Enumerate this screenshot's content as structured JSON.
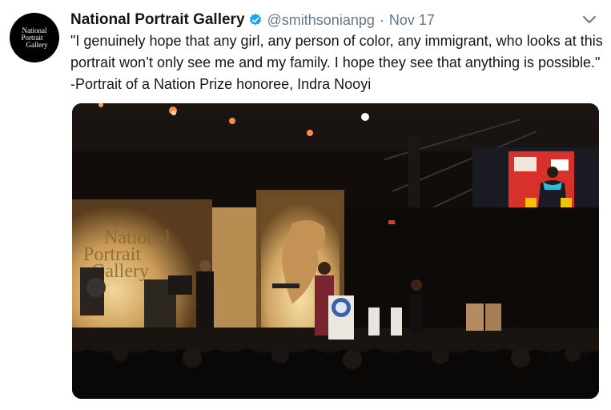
{
  "tweet": {
    "avatar_lines": [
      "National",
      "Portrait",
      "Gallery"
    ],
    "display_name": "National Portrait Gallery",
    "handle": "@smithsonianpg",
    "separator": "·",
    "date": "Nov 17",
    "text": "\"I genuinely hope that any girl, any person of color, any immigrant, who looks at this portrait won’t only see me and my family. I hope they see that anything is possible.\" -Portrait of a Nation Prize honoree, Indra Nooyi",
    "media": {
      "backdrop_words": [
        "National",
        "Portrait",
        "Gallery"
      ]
    }
  },
  "icons": {
    "verified": "verified-badge-icon",
    "menu": "chevron-down-icon"
  },
  "colors": {
    "verified": "#1da1f2",
    "secondary_text": "#657786",
    "primary_text": "#14171a",
    "screen_red": "#d8302b"
  }
}
